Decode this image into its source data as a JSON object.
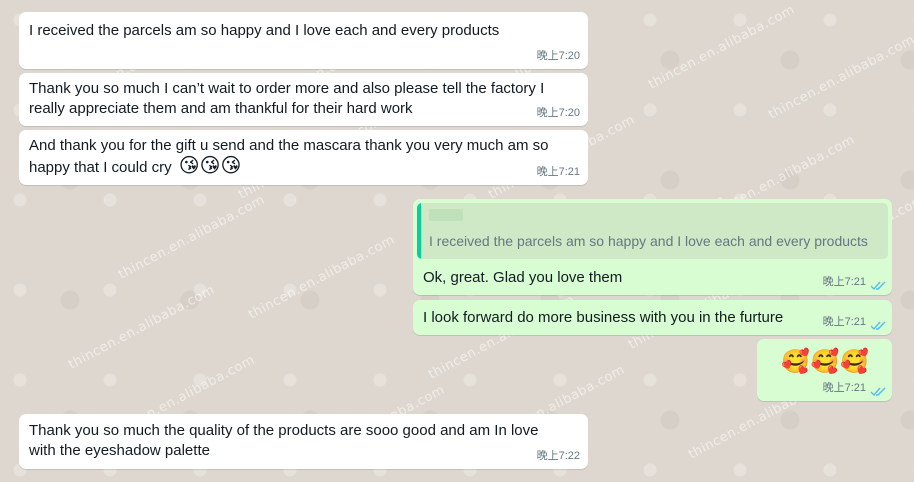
{
  "watermark": "thincen.en.alibaba.com",
  "messages": [
    {
      "lines": [
        "I received the parcels am so happy and I love each and every products"
      ],
      "time": "晚上7:20"
    },
    {
      "lines": [
        "Thank you so much I can’t wait to order more and also please tell the factory I",
        "really appreciate them and am thankful for their hard work"
      ],
      "time": "晚上7:20"
    },
    {
      "lines": [
        "And thank you for the gift u send and the mascara thank you very much am so",
        "happy that I could cry"
      ],
      "emoji": "😘😘😘",
      "time": "晚上7:21"
    },
    {
      "quote": "I received the parcels am so happy and I love each and every products",
      "text": "Ok, great. Glad you love them",
      "time": "晚上7:21"
    },
    {
      "text": "I look forward do more business with you in the furture",
      "time": "晚上7:21"
    },
    {
      "emoji": "🥰🥰🥰",
      "time": "晚上7:21"
    },
    {
      "lines": [
        "Thank you  so much the quality of the products are sooo good and am In love",
        "with the eyeshadow palette"
      ],
      "time": "晚上7:22"
    }
  ],
  "colors": {
    "incoming": "#ffffff",
    "outgoing": "#d9fdd3",
    "read_ticks": "#53bdeb",
    "background": "#ddd7cf"
  },
  "icons": {
    "read_receipt": "double-check-icon"
  }
}
